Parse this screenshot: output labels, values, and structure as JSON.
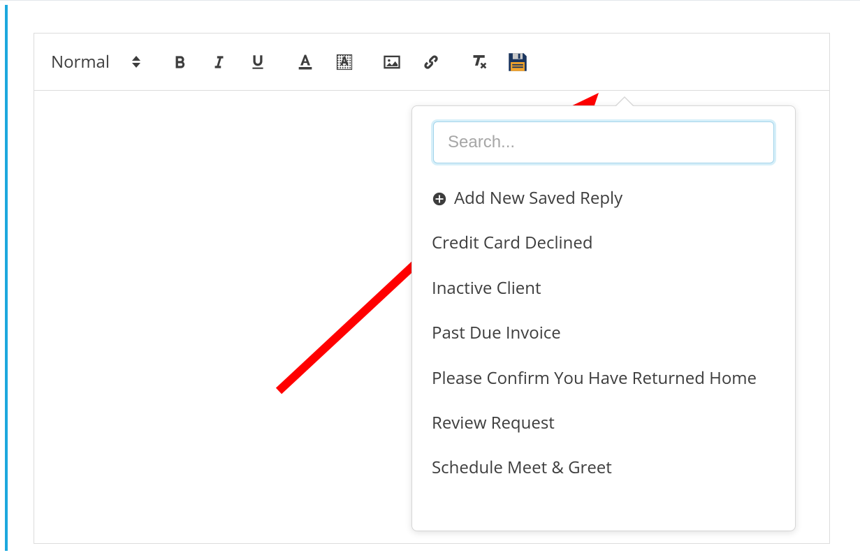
{
  "format_picker": {
    "label": "Normal"
  },
  "search": {
    "placeholder": "Search...",
    "value": ""
  },
  "saved_replies": {
    "add_label": "Add New Saved Reply",
    "items": [
      "Credit Card Declined",
      "Inactive Client",
      "Past Due Invoice",
      "Please Confirm You Have Returned Home",
      "Review Request",
      "Schedule Meet & Greet"
    ]
  },
  "icons": {
    "bold": "bold-icon",
    "italic": "italic-icon",
    "underline": "underline-icon",
    "font_color": "font-color-icon",
    "highlight": "highlight-icon",
    "image": "image-icon",
    "link": "link-icon",
    "clear_format": "clear-format-icon",
    "saved_reply": "save-disk-icon"
  },
  "colors": {
    "accent": "#1ca8dd",
    "save_icon_top": "#1b355e",
    "save_icon_band": "#f3a42a"
  }
}
